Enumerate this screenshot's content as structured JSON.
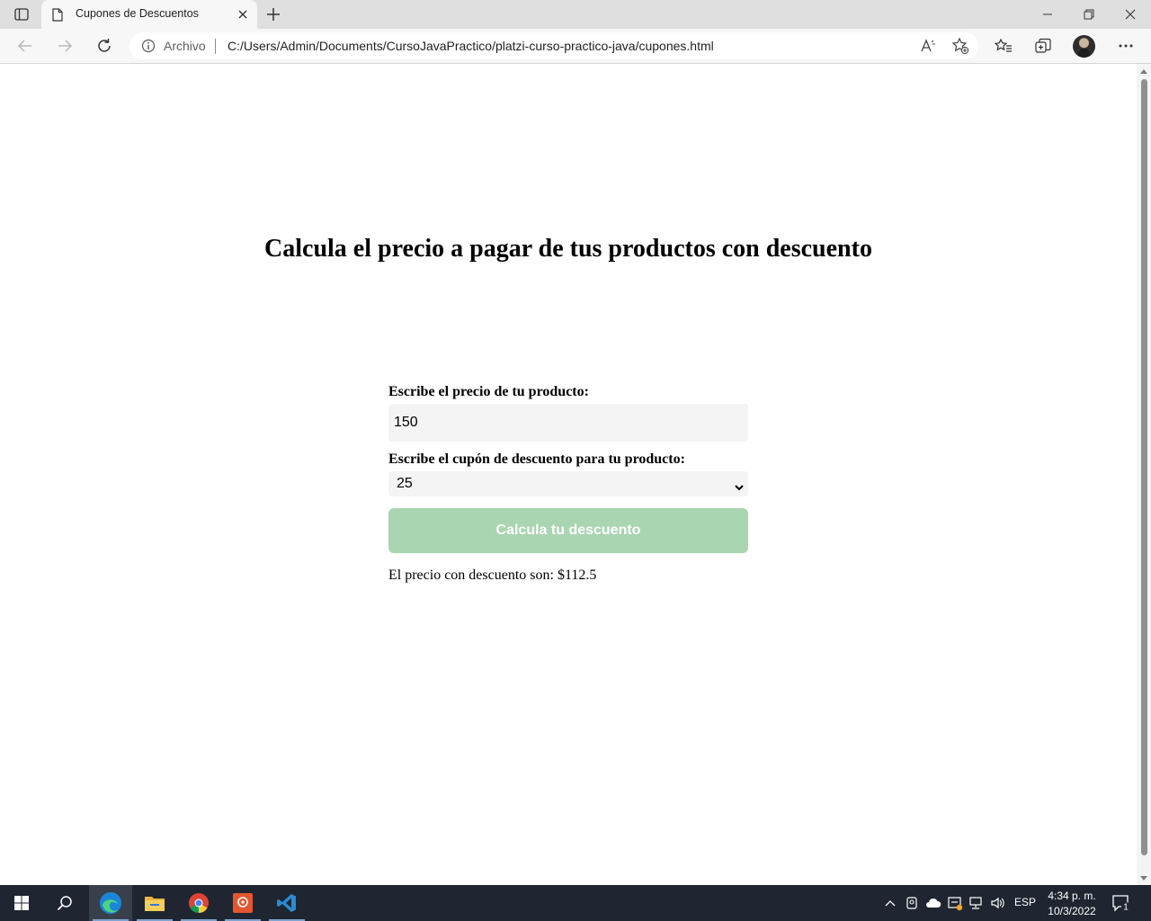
{
  "browser": {
    "tab_title": "Cupones de Descuentos",
    "origin_label": "Archivo",
    "url": "C:/Users/Admin/Documents/CursoJavaPractico/platzi-curso-practico-java/cupones.html"
  },
  "page": {
    "title": "Calcula el precio a pagar de tus productos con descuento",
    "price_label": "Escribe el precio de tu producto:",
    "price_value": "150",
    "coupon_label": "Escribe el cupón de descuento para tu producto:",
    "coupon_selected": "25",
    "button_label": "Calcula tu descuento",
    "result_text": "El precio con descuento son: $112.5",
    "button_color": "#a9d5b1"
  },
  "taskbar": {
    "language": "ESP",
    "time": "4:34 p. m.",
    "date": "10/3/2022",
    "notification_count": "1"
  }
}
